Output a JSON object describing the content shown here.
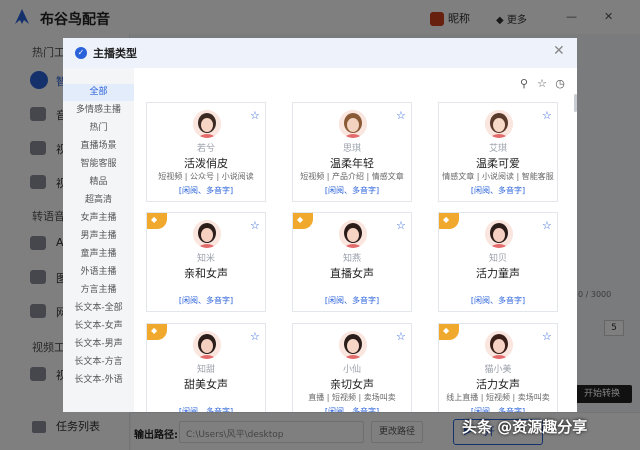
{
  "app": {
    "title": "布谷鸟配音",
    "nickname": "昵称",
    "more": "更多",
    "minimize": "—",
    "close": "✕"
  },
  "sidebar": {
    "section1": "热门工",
    "item1": "智",
    "item2": "音",
    "item3": "视",
    "item4": "视",
    "section2": "转语音",
    "item5": "A",
    "item6": "图",
    "item7": "网",
    "section3": "视频工",
    "item8": "视",
    "tasks": "任务列表"
  },
  "bottom": {
    "output_label": "输出路径:",
    "output_path": "C:\\Users\\风平\\desktop",
    "change_path": "更改路径",
    "start": "开",
    "tooltip": "开始转换",
    "counter": "0 / 3000",
    "speed": "5"
  },
  "modal": {
    "title": "主播类型",
    "close": "✕",
    "categories": [
      "全部",
      "多情感主播",
      "热门",
      "直播场景",
      "智能客服",
      "精品",
      "超高清",
      "女声主播",
      "男声主播",
      "童声主播",
      "外语主播",
      "方言主播",
      "长文本-全部",
      "长文本-女声",
      "长文本-男声",
      "长文本-方言",
      "长文本-外语"
    ],
    "active_category": "全部",
    "tools": [
      "search-icon",
      "star-icon",
      "history-icon"
    ],
    "cards": [
      {
        "name": "若兮",
        "style": "活泼俏皮",
        "tags": "短视频 | 公众号 | 小说阅读",
        "footer": "[闲阅、多音字]",
        "premium": false,
        "skin": "#f6d5c4",
        "hair": "#3b2a24"
      },
      {
        "name": "思琪",
        "style": "温柔年轻",
        "tags": "短视频 | 产品介绍 | 情感文章",
        "footer": "[闲阅、多音字]",
        "premium": false,
        "skin": "#f3d2c0",
        "hair": "#8a5a36"
      },
      {
        "name": "艾琪",
        "style": "温柔可爱",
        "tags": "情感文章 | 小说阅读 | 智能客服",
        "footer": "[闲阅、多音字]",
        "premium": false,
        "skin": "#f7d9c8",
        "hair": "#5a3a2a"
      },
      {
        "name": "知米",
        "style": "亲和女声",
        "tags": "",
        "footer": "[闲阅、多音字]",
        "premium": true,
        "skin": "#f5cfc0",
        "hair": "#2b1d1a"
      },
      {
        "name": "知燕",
        "style": "直播女声",
        "tags": "",
        "footer": "[闲阅、多音字]",
        "premium": true,
        "skin": "#f6d3c3",
        "hair": "#2b1d1a"
      },
      {
        "name": "知贝",
        "style": "活力童声",
        "tags": "",
        "footer": "[闲阅、多音字]",
        "premium": true,
        "skin": "#f5d0c2",
        "hair": "#2b1d1a"
      },
      {
        "name": "知甜",
        "style": "甜美女声",
        "tags": "",
        "footer": "[闲阅、多音字]",
        "premium": true,
        "skin": "#f4cfbf",
        "hair": "#2b1d1a"
      },
      {
        "name": "小仙",
        "style": "亲切女声",
        "tags": "直播 | 短视频 | 卖场叫卖",
        "footer": "[闲阅、多音字]",
        "premium": false,
        "skin": "#f6d6c6",
        "hair": "#2b1d1a"
      },
      {
        "name": "猫小美",
        "style": "活力女声",
        "tags": "线上直播 | 短视频 | 卖场叫卖",
        "footer": "[闲阅、多音字]",
        "premium": true,
        "skin": "#f5d2c4",
        "hair": "#3a1f18"
      }
    ]
  },
  "watermark": "头条 @资源趣分享"
}
